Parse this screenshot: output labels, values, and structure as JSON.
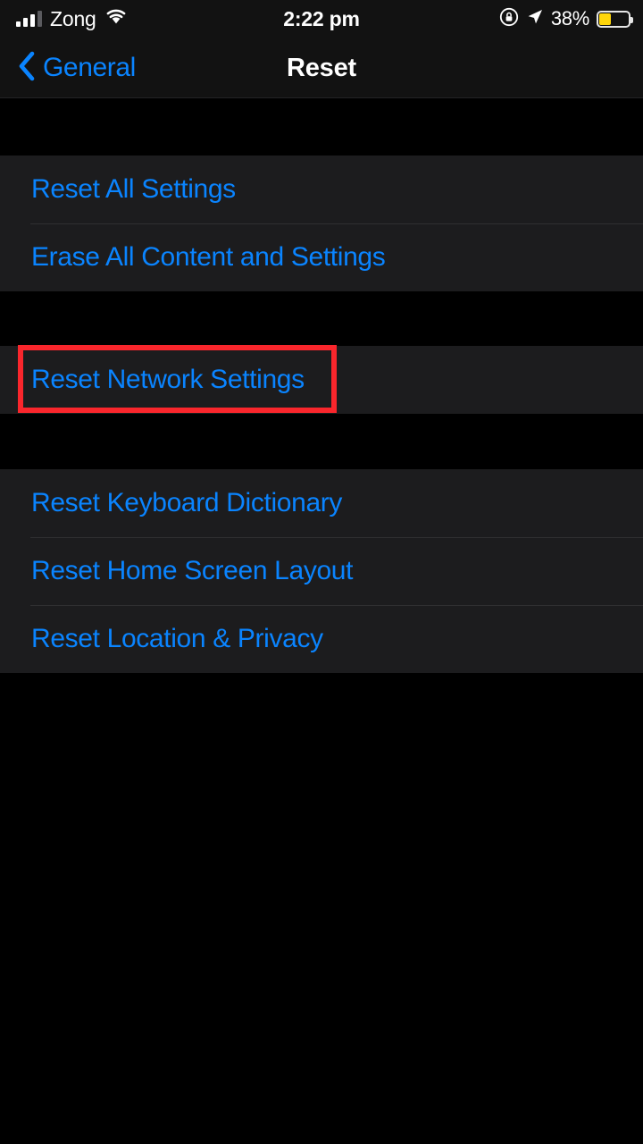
{
  "status_bar": {
    "carrier": "Zong",
    "time": "2:22 pm",
    "battery_percent": "38%",
    "signal_icon": "cellular-signal-icon",
    "wifi_icon": "wifi-icon",
    "rotation_lock_icon": "rotation-lock-icon",
    "location_icon": "location-arrow-icon",
    "battery_icon": "battery-low-power-icon",
    "battery_fill_color": "#ffd60a",
    "signal_bars_filled": 3,
    "signal_bars_total": 4
  },
  "nav_bar": {
    "back_label": "General",
    "back_icon": "chevron-left-icon",
    "title": "Reset"
  },
  "theme": {
    "background": "#000000",
    "card_background": "#1c1c1e",
    "accent_blue": "#0a84ff",
    "separator": "#2f2f31",
    "title_color": "#ffffff",
    "annotation_color": "#f9262c"
  },
  "groups": [
    {
      "id": "group-1",
      "rows": [
        {
          "label": "Reset All Settings"
        },
        {
          "label": "Erase All Content and Settings"
        }
      ]
    },
    {
      "id": "group-2",
      "rows": [
        {
          "label": "Reset Network Settings"
        }
      ]
    },
    {
      "id": "group-3",
      "rows": [
        {
          "label": "Reset Keyboard Dictionary"
        },
        {
          "label": "Reset Home Screen Layout"
        },
        {
          "label": "Reset Location & Privacy"
        }
      ]
    }
  ],
  "annotation": {
    "target": "Reset Network Settings",
    "shape": "rectangle-highlight"
  }
}
